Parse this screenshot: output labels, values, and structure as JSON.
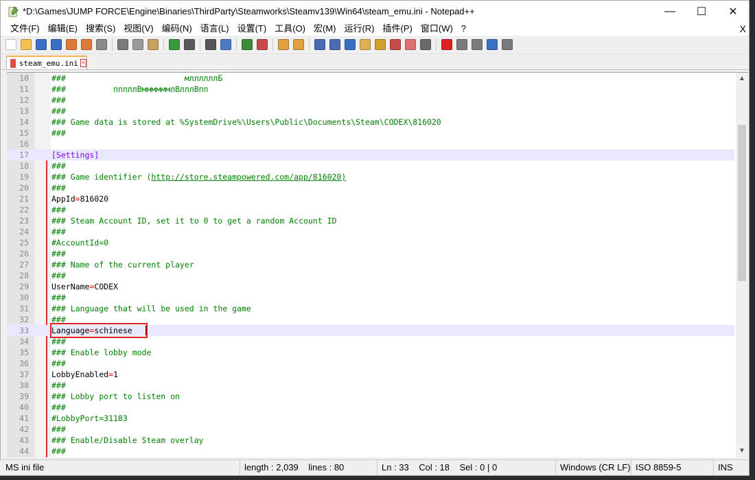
{
  "window": {
    "title": "*D:\\Games\\JUMP FORCE\\Engine\\Binaries\\ThirdParty\\Steamworks\\Steamv139\\Win64\\steam_emu.ini - Notepad++",
    "minimize": "—",
    "maximize": "☐",
    "close": "✕"
  },
  "menu": {
    "items": [
      "文件(F)",
      "编辑(E)",
      "搜索(S)",
      "视图(V)",
      "编码(N)",
      "语言(L)",
      "设置(T)",
      "工具(O)",
      "宏(M)",
      "运行(R)",
      "插件(P)",
      "窗口(W)",
      "?"
    ],
    "close": "X"
  },
  "toolbar": {
    "buttons": [
      {
        "name": "new-file-icon",
        "color": "#ffffff"
      },
      {
        "name": "open-file-icon",
        "color": "#f2c14e"
      },
      {
        "name": "save-icon",
        "color": "#3a6fc4"
      },
      {
        "name": "save-all-icon",
        "color": "#3a6fc4"
      },
      {
        "name": "close-icon",
        "color": "#e07a3a"
      },
      {
        "name": "close-all-icon",
        "color": "#e07a3a"
      },
      {
        "name": "print-icon",
        "color": "#8a8a8a"
      },
      {
        "name": "sep"
      },
      {
        "name": "cut-icon",
        "color": "#7a7a7a"
      },
      {
        "name": "copy-icon",
        "color": "#9a9a9a"
      },
      {
        "name": "paste-icon",
        "color": "#c8a060"
      },
      {
        "name": "sep"
      },
      {
        "name": "undo-icon",
        "color": "#3a9a3a"
      },
      {
        "name": "redo-icon",
        "color": "#5a5a5a"
      },
      {
        "name": "sep"
      },
      {
        "name": "find-icon",
        "color": "#555555"
      },
      {
        "name": "replace-icon",
        "color": "#4a7ac4"
      },
      {
        "name": "sep"
      },
      {
        "name": "zoom-in-icon",
        "color": "#3a8a3a"
      },
      {
        "name": "zoom-out-icon",
        "color": "#c84a4a"
      },
      {
        "name": "sep"
      },
      {
        "name": "sync-v-icon",
        "color": "#e0a040"
      },
      {
        "name": "sync-h-icon",
        "color": "#e0a040"
      },
      {
        "name": "sep"
      },
      {
        "name": "word-wrap-icon",
        "color": "#4a6ab4"
      },
      {
        "name": "show-all-chars-icon",
        "color": "#4a6ab4"
      },
      {
        "name": "indent-guide-icon",
        "color": "#3a6fc4"
      },
      {
        "name": "user-lang-icon",
        "color": "#e0b050"
      },
      {
        "name": "doc-map-icon",
        "color": "#d0a030"
      },
      {
        "name": "function-list-icon",
        "color": "#c84a4a"
      },
      {
        "name": "folder-workspace-icon",
        "color": "#e07070"
      },
      {
        "name": "monitor-icon",
        "color": "#6a6a6a"
      },
      {
        "name": "sep"
      },
      {
        "name": "record-macro-icon",
        "color": "#e02020"
      },
      {
        "name": "stop-record-icon",
        "color": "#7a7a7a"
      },
      {
        "name": "play-macro-icon",
        "color": "#7a7a7a"
      },
      {
        "name": "play-multiple-icon",
        "color": "#3a6fc4"
      },
      {
        "name": "save-macro-icon",
        "color": "#7a7a7a"
      }
    ]
  },
  "tab": {
    "label": "steam_emu.ini",
    "close": "×"
  },
  "editor": {
    "lines": [
      {
        "n": "10",
        "type": "comment",
        "text": "###                         мллллллБ"
      },
      {
        "n": "11",
        "type": "comment",
        "text": "###          пппллВммммммлВлллВпп"
      },
      {
        "n": "12",
        "type": "comment",
        "text": "###"
      },
      {
        "n": "13",
        "type": "comment",
        "text": "###"
      },
      {
        "n": "14",
        "type": "comment",
        "text": "### Game data is stored at %SystemDrive%\\Users\\Public\\Documents\\Steam\\CODEX\\816020"
      },
      {
        "n": "15",
        "type": "comment",
        "text": "###"
      },
      {
        "n": "16",
        "type": "blank",
        "text": ""
      },
      {
        "n": "17",
        "type": "section",
        "text": "[Settings]"
      },
      {
        "n": "18",
        "type": "comment",
        "text": "###"
      },
      {
        "n": "19",
        "type": "link",
        "pre": "### Game identifier (",
        "link": "http://store.steampowered.com/app/816020)"
      },
      {
        "n": "20",
        "type": "comment",
        "text": "###"
      },
      {
        "n": "21",
        "type": "kv",
        "key": "AppId",
        "val": "816020"
      },
      {
        "n": "22",
        "type": "comment",
        "text": "###"
      },
      {
        "n": "23",
        "type": "comment",
        "text": "### Steam Account ID, set it to 0 to get a random Account ID"
      },
      {
        "n": "24",
        "type": "comment",
        "text": "###"
      },
      {
        "n": "25",
        "type": "comment",
        "text": "#AccountId=0"
      },
      {
        "n": "26",
        "type": "comment",
        "text": "###"
      },
      {
        "n": "27",
        "type": "comment",
        "text": "### Name of the current player"
      },
      {
        "n": "28",
        "type": "comment",
        "text": "###"
      },
      {
        "n": "29",
        "type": "kv",
        "key": "UserName",
        "val": "CODEX"
      },
      {
        "n": "30",
        "type": "comment",
        "text": "###"
      },
      {
        "n": "31",
        "type": "comment",
        "text": "### Language that will be used in the game"
      },
      {
        "n": "32",
        "type": "comment",
        "text": "###"
      },
      {
        "n": "33",
        "type": "kv",
        "key": "Language",
        "val": "schinese",
        "current": true
      },
      {
        "n": "34",
        "type": "comment",
        "text": "###"
      },
      {
        "n": "35",
        "type": "comment",
        "text": "### Enable lobby mode"
      },
      {
        "n": "36",
        "type": "comment",
        "text": "###"
      },
      {
        "n": "37",
        "type": "kv",
        "key": "LobbyEnabled",
        "val": "1"
      },
      {
        "n": "38",
        "type": "comment",
        "text": "###"
      },
      {
        "n": "39",
        "type": "comment",
        "text": "### Lobby port to listen on"
      },
      {
        "n": "40",
        "type": "comment",
        "text": "###"
      },
      {
        "n": "41",
        "type": "comment",
        "text": "#LobbyPort=31183"
      },
      {
        "n": "42",
        "type": "comment",
        "text": "###"
      },
      {
        "n": "43",
        "type": "comment",
        "text": "### Enable/Disable Steam overlay"
      },
      {
        "n": "44",
        "type": "comment",
        "text": "###"
      }
    ]
  },
  "status": {
    "filetype": "MS ini file",
    "length": "length : 2,039",
    "lines": "lines : 80",
    "ln": "Ln : 33",
    "col": "Col : 18",
    "sel": "Sel : 0 | 0",
    "eol": "Windows (CR LF)",
    "encoding": "ISO 8859-5",
    "mode": "INS"
  }
}
